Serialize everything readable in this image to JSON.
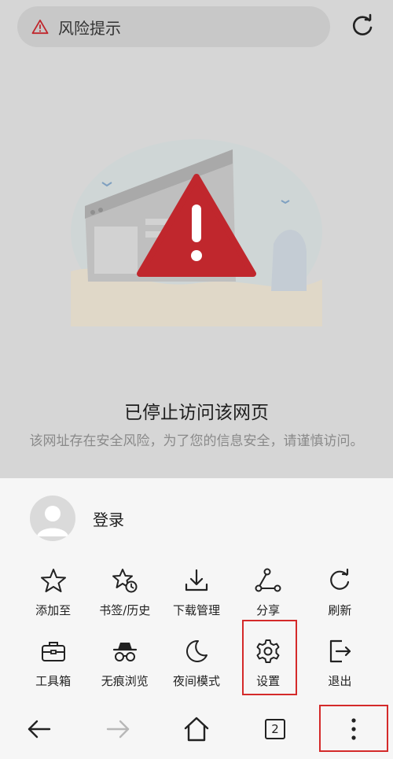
{
  "url_bar": {
    "title": "风险提示",
    "warning_icon": "warning-triangle-icon",
    "reload_icon": "reload-icon"
  },
  "blocked_page": {
    "heading": "已停止访问该网页",
    "description": "该网址存在安全风险，为了您的信息安全，请谨慎访问。"
  },
  "menu": {
    "login_label": "登录",
    "items": [
      {
        "label": "添加至",
        "icon": "star-icon"
      },
      {
        "label": "书签/历史",
        "icon": "bookmark-history-icon"
      },
      {
        "label": "下载管理",
        "icon": "download-icon"
      },
      {
        "label": "分享",
        "icon": "share-icon"
      },
      {
        "label": "刷新",
        "icon": "refresh-icon"
      },
      {
        "label": "工具箱",
        "icon": "toolbox-icon"
      },
      {
        "label": "无痕浏览",
        "icon": "incognito-icon"
      },
      {
        "label": "夜间模式",
        "icon": "moon-icon"
      },
      {
        "label": "设置",
        "icon": "gear-icon"
      },
      {
        "label": "退出",
        "icon": "exit-icon"
      }
    ]
  },
  "bottom_nav": {
    "tab_count": "2"
  },
  "colors": {
    "accent_red": "#c0272d",
    "highlight_red": "#d42a2a",
    "background": "#d6d6d6",
    "sheet": "#f6f6f6"
  }
}
